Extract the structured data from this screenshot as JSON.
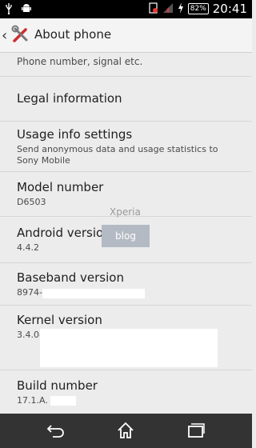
{
  "status": {
    "battery": "82%",
    "time": "20:41"
  },
  "header": {
    "title": "About phone"
  },
  "items": [
    {
      "partial_subtitle": "Phone number, signal etc."
    },
    {
      "title": "Legal information"
    },
    {
      "title": "Usage info settings",
      "subtitle": "Send anonymous data and usage statistics to Sony Mobile"
    },
    {
      "title": "Model number",
      "value": "D6503"
    },
    {
      "title": "Android version",
      "value": "4.4.2"
    },
    {
      "title": "Baseband version",
      "value": "8974-"
    },
    {
      "title": "Kernel version",
      "value": "3.4.0-"
    },
    {
      "title": "Build number",
      "value": "17.1.A."
    }
  ],
  "watermark": {
    "line1": "Xperia",
    "line2": "blog"
  }
}
